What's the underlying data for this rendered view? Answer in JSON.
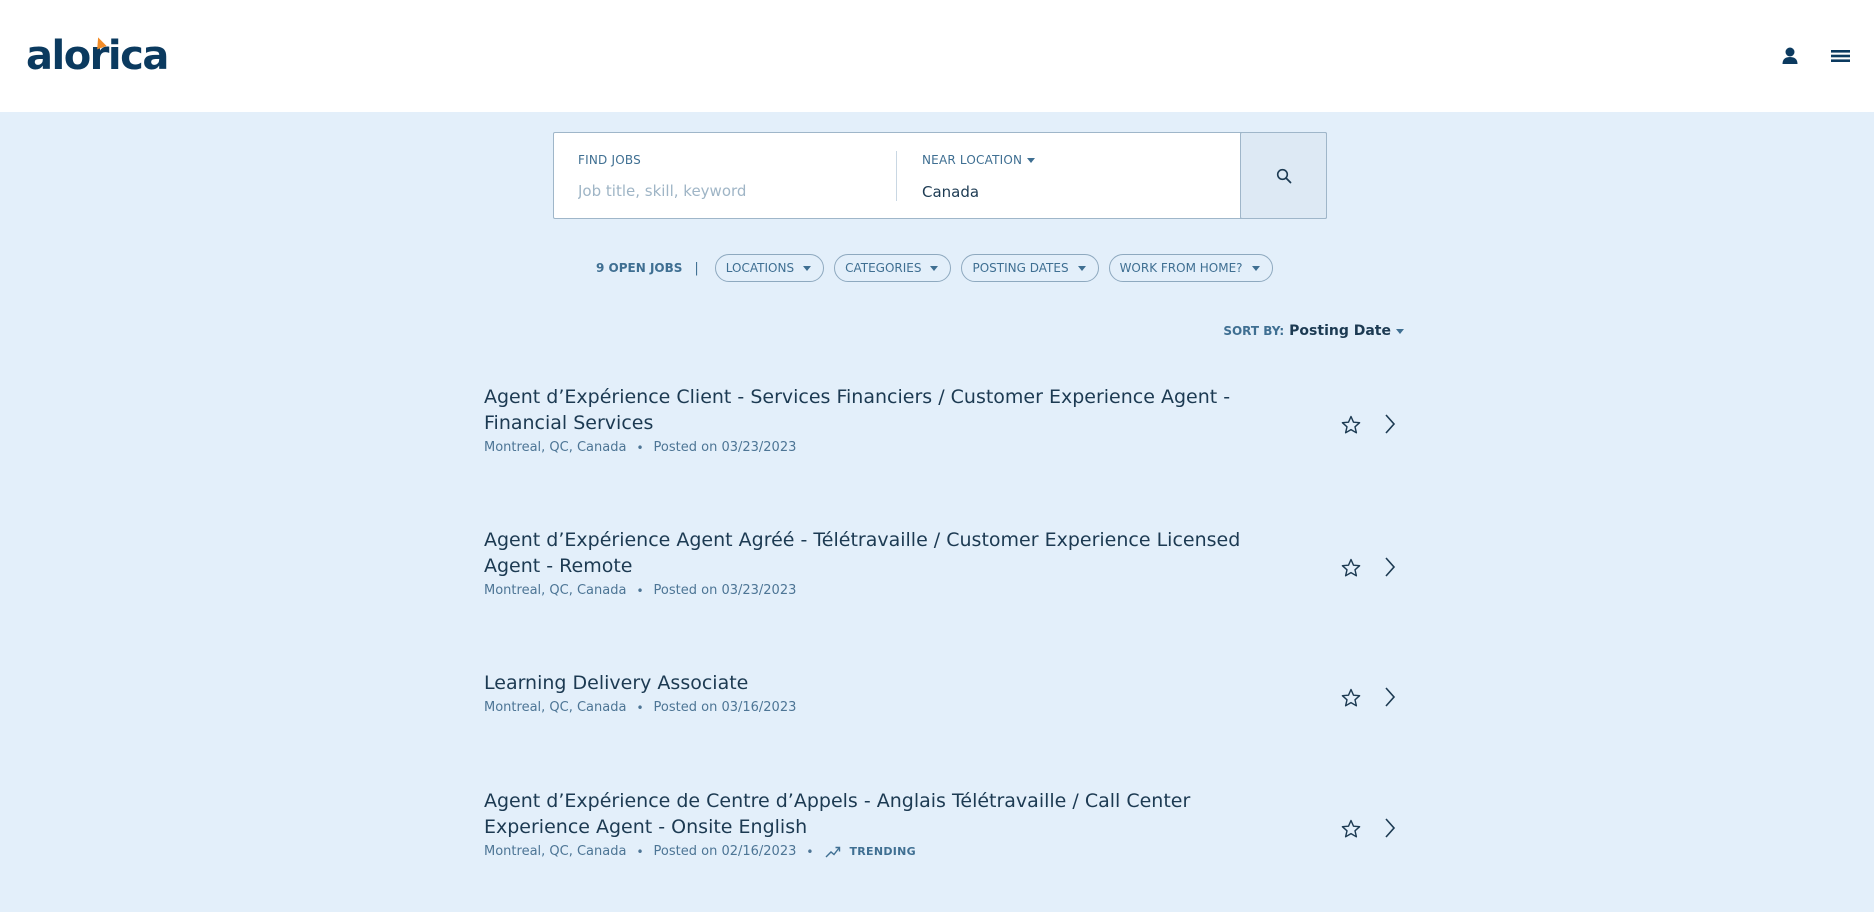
{
  "brand": {
    "logo_text": "alorica",
    "accent_color": "#f28c28",
    "primary_color": "#0b3a5f"
  },
  "header": {
    "icons": [
      "user-icon",
      "hamburger-menu-icon"
    ]
  },
  "search": {
    "find_label": "FIND JOBS",
    "find_placeholder": "Job title, skill, keyword",
    "find_value": "",
    "near_label": "NEAR LOCATION",
    "near_value": "Canada",
    "button_icon": "search-icon"
  },
  "filters": {
    "open_jobs": "9 OPEN JOBS",
    "separator": "|",
    "pills": [
      "LOCATIONS",
      "CATEGORIES",
      "POSTING DATES",
      "WORK FROM HOME?"
    ]
  },
  "sort": {
    "label": "SORT BY:",
    "value": "Posting Date"
  },
  "jobs": [
    {
      "title": "Agent d’Expérience Client - Services Financiers / Customer Experience Agent - Financial Services",
      "location": "Montreal, QC, Canada",
      "posted": "Posted on 03/23/2023",
      "trending": ""
    },
    {
      "title": "Agent d’Expérience Agent Agréé - Télétravaille / Customer Experience Licensed Agent - Remote",
      "location": "Montreal, QC, Canada",
      "posted": "Posted on 03/23/2023",
      "trending": ""
    },
    {
      "title": "Learning Delivery Associate",
      "location": "Montreal, QC, Canada",
      "posted": "Posted on 03/16/2023",
      "trending": ""
    },
    {
      "title": "Agent d’Expérience de Centre d’Appels - Anglais Télétravaille / Call Center Experience Agent - Onsite English",
      "location": "Montreal, QC, Canada",
      "posted": "Posted on 02/16/2023",
      "trending": "TRENDING"
    }
  ],
  "bullet": "•"
}
